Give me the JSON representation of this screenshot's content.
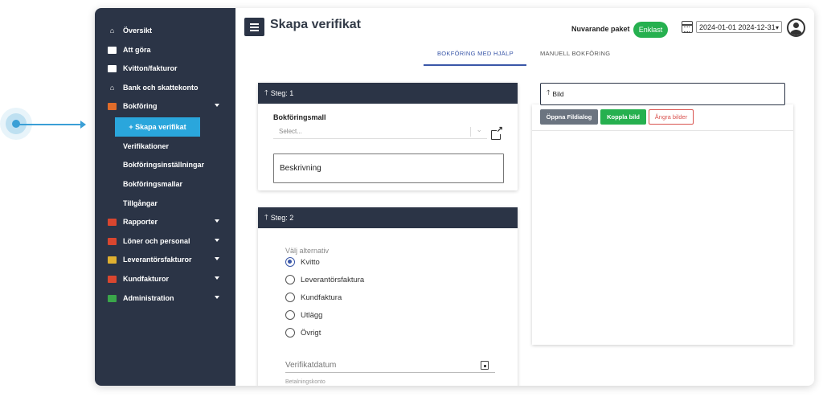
{
  "header": {
    "title": "Skapa verifikat",
    "package_label": "Nuvarande paket",
    "package_badge": "Enklast",
    "date_range": "2024-01-01 2024-12-31"
  },
  "tabs": [
    {
      "label": "BOKFÖRING MED HJÄLP",
      "active": true
    },
    {
      "label": "MANUELL BOKFÖRING",
      "active": false
    }
  ],
  "sidebar": {
    "items": [
      {
        "label": "Översikt",
        "icon": "home-icon"
      },
      {
        "label": "Att göra",
        "icon": "todo-icon"
      },
      {
        "label": "Kvitton/fakturor",
        "icon": "receipt-icon"
      },
      {
        "label": "Bank och skattekonto",
        "icon": "bank-icon"
      },
      {
        "label": "Bokföring",
        "icon": "book-icon",
        "expanded": true
      },
      {
        "label": "Rapporter",
        "icon": "chart-icon"
      },
      {
        "label": "Löner och personal",
        "icon": "payroll-icon"
      },
      {
        "label": "Leverantörsfakturor",
        "icon": "supplier-icon"
      },
      {
        "label": "Kundfakturor",
        "icon": "customer-icon"
      },
      {
        "label": "Administration",
        "icon": "admin-icon"
      }
    ],
    "sub_items": [
      {
        "label": "+ Skapa verifikat",
        "active": true
      },
      {
        "label": "Verifikationer"
      },
      {
        "label": "Bokföringsinställningar"
      },
      {
        "label": "Bokföringsmallar"
      },
      {
        "label": "Tillgångar"
      }
    ]
  },
  "step1": {
    "header": "Steg: 1",
    "template_label": "Bokföringsmall",
    "template_placeholder": "Select...",
    "description": "Beskrivning"
  },
  "step2": {
    "header": "Steg: 2",
    "choose_label": "Välj alternativ",
    "options": [
      "Kvitto",
      "Leverantörsfaktura",
      "Kundfaktura",
      "Utlägg",
      "Övrigt"
    ],
    "selected": "Kvitto",
    "date_label": "Verifikatdatum",
    "cut_label": "Betalningskonto"
  },
  "image": {
    "label": "Bild",
    "open_dialog": "Öppna Fildialog",
    "link_image": "Koppla bild",
    "undo_images": "Ångra bilder"
  },
  "colors": {
    "sidebar": "#2b3446",
    "accent": "#2aa6dc",
    "tab_active": "#3a57a8",
    "green": "#26b04f"
  }
}
